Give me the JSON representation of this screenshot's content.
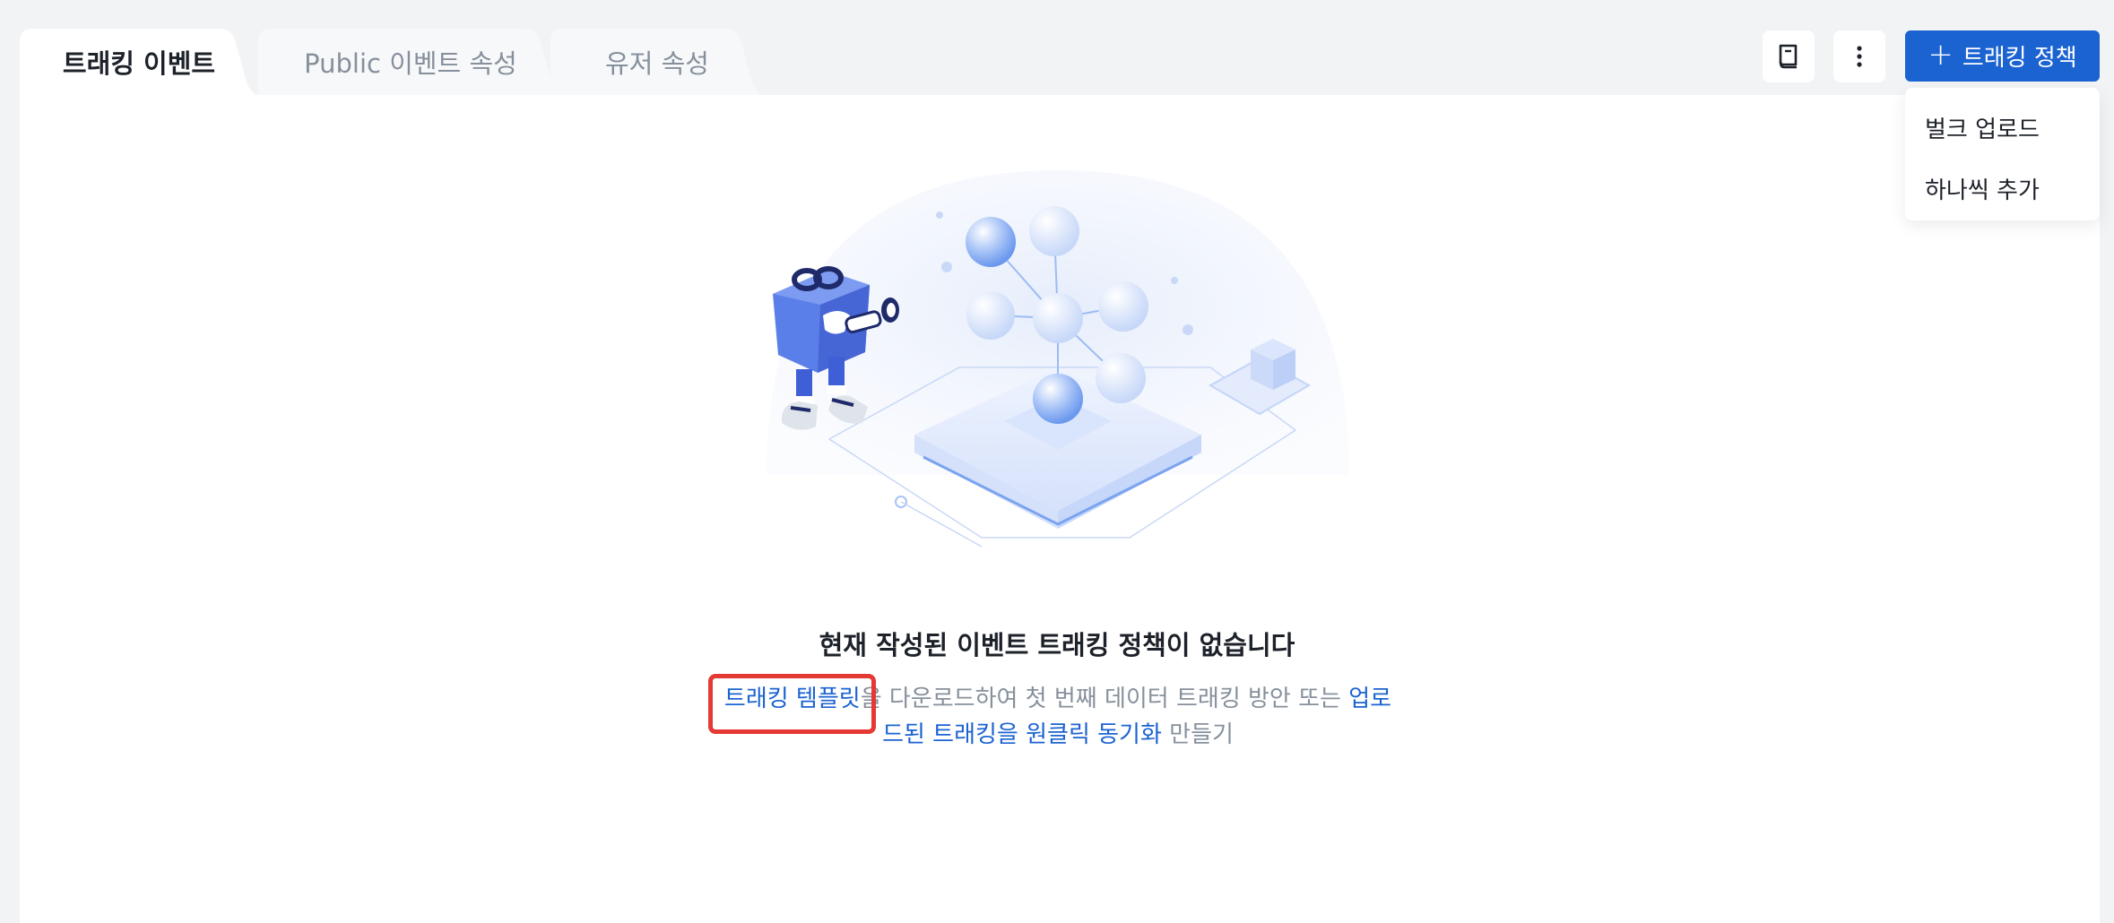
{
  "tabs": [
    {
      "label": "트래킹 이벤트",
      "active": true
    },
    {
      "label": "Public 이벤트 속성",
      "active": false
    },
    {
      "label": "유저 속성",
      "active": false
    }
  ],
  "toolbar": {
    "book_icon": "book-icon",
    "more_icon": "more-vertical-icon",
    "add_button_label": "트래킹 정책",
    "add_icon": "plus-icon"
  },
  "dropdown": {
    "items": [
      "벌크 업로드",
      "하나씩 추가"
    ]
  },
  "empty_state": {
    "title": "현재 작성된 이벤트 트래킹 정책이 없습니다",
    "link1": "트래킹 템플릿",
    "text1": "을 다운로드하여 첫 번째 데이터 트래킹 방안 또는 ",
    "link2": "업로드된 트래킹을 원클릭 동기화",
    "text2": " 만들기"
  },
  "colors": {
    "primary": "#1b63d1",
    "background": "#f2f3f5",
    "highlight": "#e53935"
  }
}
